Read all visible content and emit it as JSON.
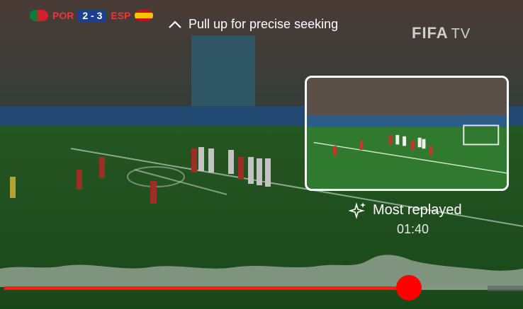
{
  "scoreboard": {
    "home_team": "POR",
    "away_team": "ESP",
    "score": "2 - 3",
    "home_flag_icon": "portugal-flag-icon",
    "away_flag_icon": "spain-flag-icon"
  },
  "seek_hint": {
    "icon": "chevron-up-icon",
    "label": "Pull up for precise seeking"
  },
  "watermark": {
    "brand": "FIFA",
    "suffix": "TV"
  },
  "preview": {
    "label": "Most replayed",
    "icon": "sparkle-icon",
    "timecode": "01:40"
  },
  "progress": {
    "played_fraction": 0.78,
    "played_color": "#ff1a1a",
    "thumb_color": "#ff0000"
  }
}
